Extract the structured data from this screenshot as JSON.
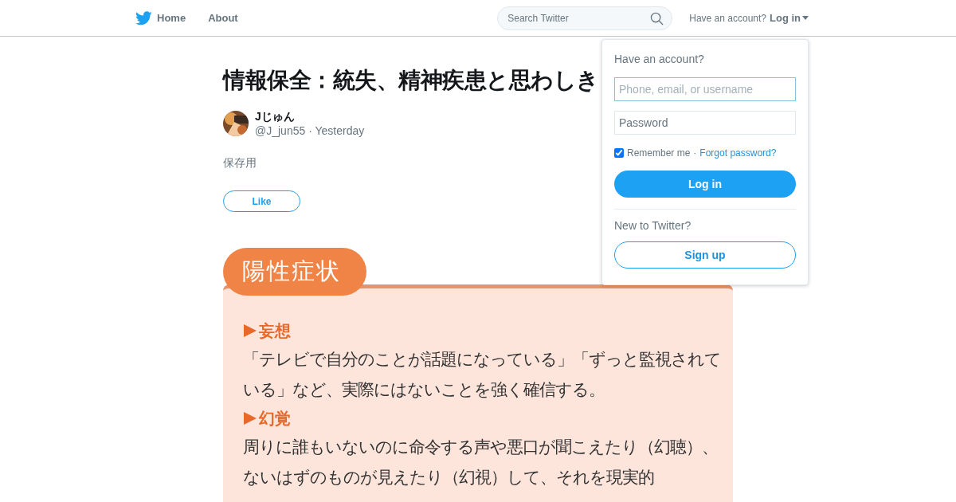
{
  "nav": {
    "items": [
      {
        "label": "Home",
        "kind": "home"
      },
      {
        "label": "About",
        "kind": "plain"
      }
    ],
    "search": {
      "placeholder": "Search Twitter"
    },
    "account_prompt": "Have an account?",
    "login_label": "Log in"
  },
  "tweet": {
    "title": "情報保全：統失、精神疾患と思わしき",
    "author": {
      "name": "Jじゅん",
      "handle": "@J_jun55",
      "separator": "·",
      "time": "Yesterday"
    },
    "text": "保存用",
    "like_label": "Like",
    "attachment": {
      "tab": "陽性症状",
      "sections": [
        {
          "heading": "妄想",
          "body": "「テレビで自分のことが話題になっている」「ずっと監視されている」など、実際にはないことを強く確信する。"
        },
        {
          "heading": "幻覚",
          "body": "周りに誰もいないのに命令する声や悪口が聞こえたり（幻聴）、ないはずのものが見えたり（幻視）して、それを現実的"
        }
      ]
    }
  },
  "login_dropdown": {
    "heading": "Have an account?",
    "username": {
      "placeholder": "Phone, email, or username"
    },
    "password": {
      "placeholder": "Password"
    },
    "remember": {
      "label": "Remember me",
      "checked": true
    },
    "separator": "·",
    "forgot_link": "Forgot password?",
    "login_button": "Log in",
    "signup_prompt": "New to Twitter?",
    "signup_button": "Sign up"
  }
}
